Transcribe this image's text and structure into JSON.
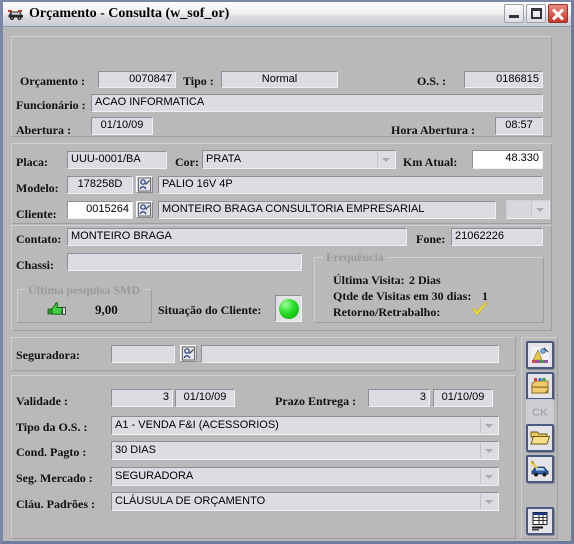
{
  "window": {
    "title": "Orçamento - Consulta (w_sof_or)",
    "icon": "car-icon",
    "minimize_label": "Minimizar",
    "maximize_label": "Maximizar",
    "close_label": "Fechar"
  },
  "form": {
    "orcamento": {
      "label": "Orçamento :",
      "value": "0070847"
    },
    "tipo": {
      "label": "Tipo :",
      "value": "Normal"
    },
    "os": {
      "label": "O.S. :",
      "value": "0186815"
    },
    "funcionario": {
      "label": "Funcionário :",
      "value": "ACAO INFORMATICA"
    },
    "abertura": {
      "label": "Abertura :",
      "value": "01/10/09"
    },
    "hora_abertura": {
      "label": "Hora Abertura :",
      "value": "08:57"
    },
    "placa": {
      "label": "Placa:",
      "value": "UUU-0001/BA"
    },
    "cor": {
      "label": "Cor:",
      "value": "PRATA"
    },
    "km_atual": {
      "label": "Km Atual:",
      "value": "48.330"
    },
    "modelo": {
      "label": "Modelo:",
      "code": "178258D",
      "value": "PALIO 16V 4P"
    },
    "cliente": {
      "label": "Cliente:",
      "code": "0015264",
      "value": "MONTEIRO BRAGA CONSULTORIA EMPRESARIAL",
      "extra": ""
    },
    "contato": {
      "label": "Contato:",
      "value": "MONTEIRO BRAGA"
    },
    "fone": {
      "label": "Fone:",
      "value": "21062226"
    },
    "chassi": {
      "label": "Chassi:",
      "value": ""
    },
    "situacao_cliente": {
      "label": "Situação do Cliente:",
      "status_color": "#2ee02e"
    },
    "seguradora": {
      "label": "Seguradora:",
      "code": "",
      "value": ""
    },
    "validade": {
      "label": "Validade :",
      "days": "3",
      "date": "01/10/09"
    },
    "prazo_entrega": {
      "label": "Prazo Entrega :",
      "days": "3",
      "date": "01/10/09"
    },
    "tipo_os": {
      "label": "Tipo da O.S. :",
      "value": "A1 - VENDA F&I (ACESSORIOS)"
    },
    "cond_pagto": {
      "label": "Cond. Pagto :",
      "value": "30 DIAS"
    },
    "seg_mercado": {
      "label": "Seg. Mercado :",
      "value": "SEGURADORA"
    },
    "clau_padroes": {
      "label": "Cláu. Padrões :",
      "value": "CLÁUSULA DE ORÇAMENTO"
    }
  },
  "pesquisa_smd": {
    "caption": "Última pesquisa SMD",
    "value": "9,00",
    "icon": "thumbs-up-icon"
  },
  "frequencia": {
    "caption": "Frequência",
    "ultima_visita_label": "Última Visita:",
    "ultima_visita_value": "2 Dias",
    "qtde_label": "Qtde de Visitas em 30 dias:",
    "qtde_value": "1",
    "retorno_label": "Retorno/Retrabalho:",
    "retorno_icon": "check-mark-icon"
  },
  "toolbar": {
    "buttons": [
      {
        "name": "paint-button",
        "icon": "paint-palette-icon",
        "label": ""
      },
      {
        "name": "toolbox-button",
        "icon": "toolbox-icon",
        "label": ""
      },
      {
        "name": "ck-button",
        "icon": "ck-icon",
        "label": "CK"
      },
      {
        "name": "open-folder-button",
        "icon": "open-folder-icon",
        "label": ""
      },
      {
        "name": "vehicle-button",
        "icon": "car-tools-icon",
        "label": ""
      },
      {
        "name": "report-button",
        "icon": "table-report-icon",
        "label": ""
      }
    ]
  },
  "colors": {
    "window_bg": "#b9b9b9",
    "field_bg": "#dcdce2",
    "editable_bg": "#ffffff",
    "accent_border": "#4a5a80",
    "status_green": "#2ee02e",
    "check_yellow": "#f2e23a"
  }
}
